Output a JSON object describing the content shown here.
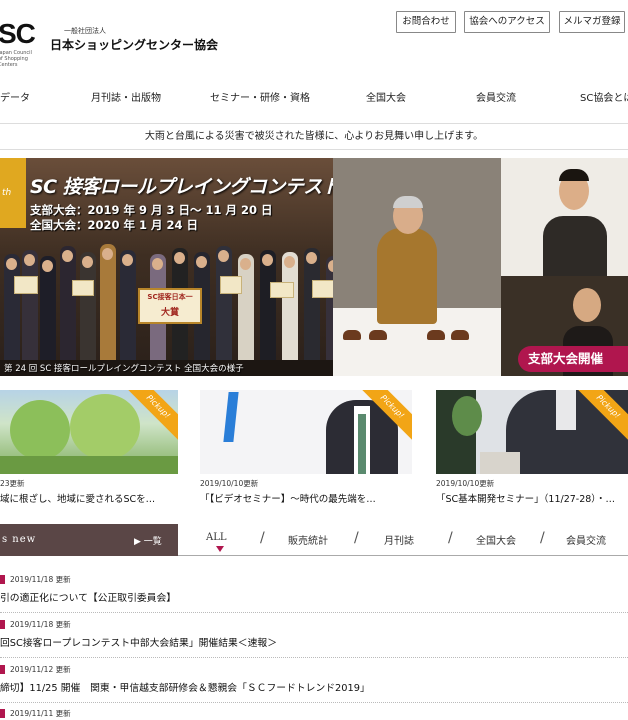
{
  "header": {
    "logo_mark": "SC",
    "logo_sub": "Japan Council of Shopping Centers",
    "org_type": "一般社団法人",
    "org_name": "日本ショッピングセンター協会",
    "buttons": [
      "お問合わせ",
      "協会へのアクセス",
      "メルマガ登録"
    ]
  },
  "nav": {
    "items": [
      "データ",
      "月刊誌・出版物",
      "セミナー・研修・資格",
      "全国大会",
      "会員交流",
      "SC協会とは"
    ]
  },
  "notice": "大雨と台風による災害で被災された皆様に、心よりお見舞い申し上げます。",
  "hero": {
    "badge": "th",
    "title": "SC 接客ロールプレイングコンテスト",
    "date_branch": "支部大会：2019 年 9 月 3 日～ 11 月 20 日",
    "date_national": "全国大会：2020 年 1 月 24 日",
    "prize_label": "SC接客日本一",
    "prize_sub": "大賞",
    "caption": "第 24 回 SC 接客ロールプレイングコンテスト 全国大会の様子",
    "pill": "支部大会開催"
  },
  "cards": [
    {
      "ribbon": "Pickup!",
      "date": "23更新",
      "title": "域に根ざし、地域に愛されるSCを…"
    },
    {
      "ribbon": "Pickup!",
      "date": "2019/10/10更新",
      "title": "「【ビデオセミナー】～時代の最先端を…"
    },
    {
      "ribbon": "Pickup!",
      "date": "2019/10/10更新",
      "title": "「SC基本開発セミナー」（11/27-28）・…"
    }
  ],
  "news": {
    "header_label": "s new",
    "list_link": "▶ 一覧",
    "tabs": [
      "ALL",
      "販売統計",
      "月刊誌",
      "全国大会",
      "会員交流"
    ],
    "items": [
      {
        "date": "2019/11/18 更新",
        "title": "引の適正化について【公正取引委員会】"
      },
      {
        "date": "2019/11/18 更新",
        "title": "回SC接客ロープレコンテスト中部大会結果」開催結果＜速報＞"
      },
      {
        "date": "2019/11/12 更新",
        "title": "締切】11/25 開催　関東・甲信越支部研修会＆懇親会「ＳＣフードトレンド2019」"
      },
      {
        "date": "2019/11/11 更新",
        "title": ""
      }
    ]
  },
  "colors": {
    "accent": "#b0164e",
    "pickup": "#f2a516",
    "news_header": "#5a4646"
  }
}
